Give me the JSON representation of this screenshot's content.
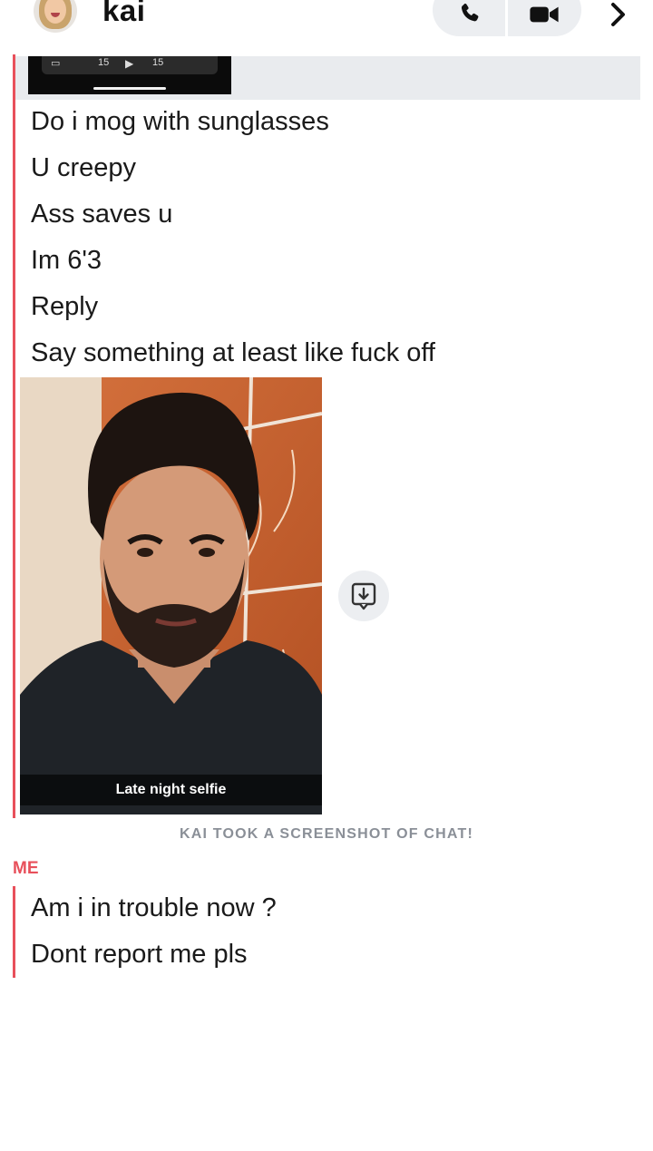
{
  "header": {
    "contact_name": "kai",
    "avatar_icon": "bitmoji-avatar-icon",
    "call_icon": "phone-icon",
    "video_icon": "video-camera-icon",
    "more_icon": "chevron-right-icon"
  },
  "video": {
    "rewind_label": "15",
    "forward_label": "15"
  },
  "messages_from_kai": [
    "Do i mog with sunglasses",
    "U creepy",
    "Ass saves u",
    "Im 6'3",
    "Reply",
    "Say something at least like fuck off"
  ],
  "snap": {
    "caption": "Late night selfie",
    "save_icon": "save-to-chat-icon"
  },
  "system_note": "KAI TOOK A SCREENSHOT OF CHAT!",
  "my_section": {
    "sender_label": "ME",
    "messages": [
      "Am i in trouble now ?",
      "Dont report me pls"
    ]
  },
  "colors": {
    "accent": "#e8505b",
    "pill_bg": "#eceef1",
    "note_gray": "#8a8f97"
  }
}
